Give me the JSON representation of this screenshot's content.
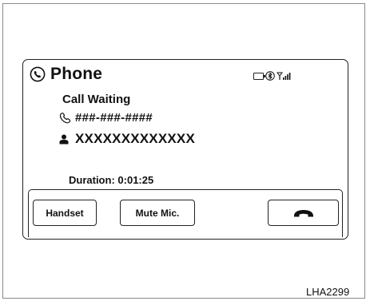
{
  "header": {
    "title": "Phone",
    "icons": [
      "phone-icon",
      "battery-icon",
      "bluetooth-icon",
      "signal-icon"
    ]
  },
  "call": {
    "status": "Call Waiting",
    "number": "###-###-####",
    "name": "XXXXXXXXXXXXX",
    "duration_label": "Duration:",
    "duration": "0:01:25"
  },
  "buttons": {
    "handset": "Handset",
    "mute": "Mute Mic.",
    "end_icon": "hang-up-icon"
  },
  "caption": "LHA2299"
}
